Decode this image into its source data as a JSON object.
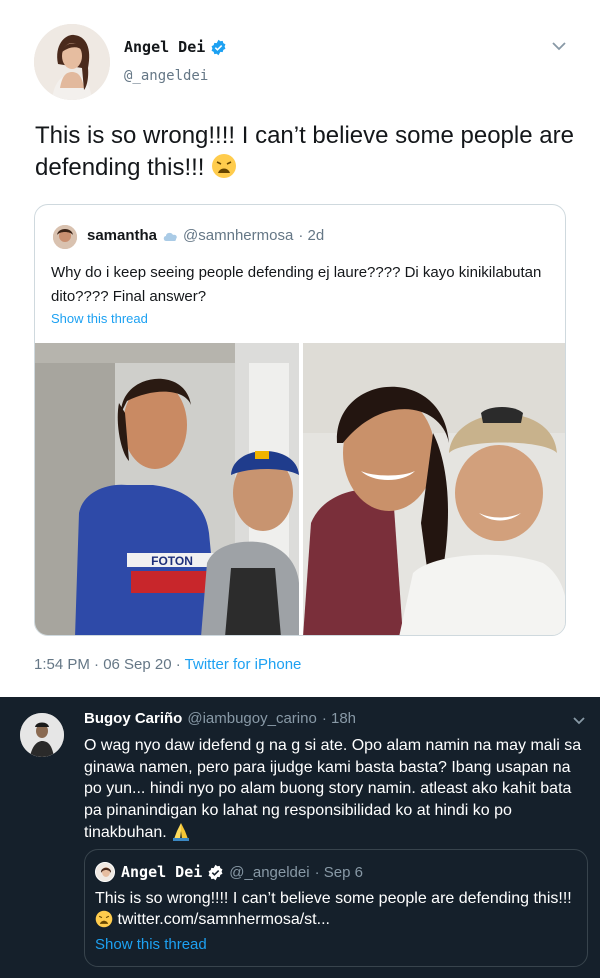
{
  "top_tweet": {
    "author_name": "Angel Dei",
    "author_handle": "@_angeldei",
    "text": "This is so wrong!!!! I can’t believe some people are defending this!!!",
    "emoji": "weary-face",
    "quoted": {
      "author_name": "samantha",
      "author_handle": "@samnhermosa",
      "time_ago": "· 2d",
      "text": "Why do i keep seeing people defending ej laure???? Di kayo kinikilabutan dito???? Final answer?",
      "show_thread": "Show this thread",
      "photos": [
        {
          "jersey_text": "FOTON"
        },
        {
          "cap_text": ""
        }
      ]
    },
    "timestamp": "1:54 PM · 06 Sep 20 · ",
    "source": "Twitter for iPhone"
  },
  "reply_tweet": {
    "author_name": "Bugoy Cariño",
    "author_handle": "@iambugoy_carino",
    "time_ago": "· 18h",
    "text": "O wag nyo daw idefend g na g si ate. Opo alam namin na may mali sa ginawa namen, pero para ijudge kami basta basta? Ibang usapan na po yun... hindi nyo po alam buong story namin. atleast ako kahit bata pa pinanindigan ko lahat ng responsibilidad ko at hindi ko po tinakbuhan.",
    "emoji": "folded-hands",
    "quoted": {
      "author_name": "Angel Dei",
      "author_handle": "@_angeldei",
      "time_ago": "· Sep 6",
      "text": "This is so wrong!!!! I can’t believe some people are defending this!!!",
      "link": "twitter.com/samnhermosa/st...",
      "show_thread": "Show this thread"
    }
  },
  "colors": {
    "twitter_blue": "#1da1f2",
    "dark_bg": "#15202b",
    "muted_light": "#657786",
    "muted_dark": "#8899a6"
  }
}
